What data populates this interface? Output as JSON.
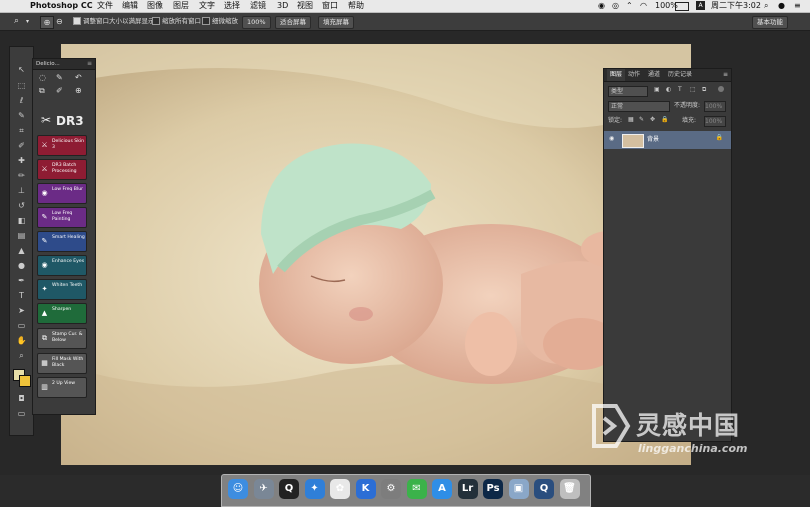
{
  "menubar": {
    "app_name": "Photoshop CC",
    "items": [
      "文件",
      "编辑",
      "图像",
      "图层",
      "文字",
      "选择",
      "滤镜",
      "3D",
      "视图",
      "窗口",
      "帮助"
    ],
    "battery": "100%",
    "clock": "周二下午3:02",
    "input_indicator": "A"
  },
  "options_bar": {
    "resize_windows_label": "调整窗口大小以满屏显示",
    "zoom_all_label": "缩放所有窗口",
    "scrubby_zoom_label": "细微缩放",
    "zoom_percent": "100%",
    "fit_screen_label": "适合屏幕",
    "fill_screen_label": "填充屏幕",
    "workspace_label": "基本功能"
  },
  "delicious_panel": {
    "title": "Delicio...",
    "logo_text": "DR3",
    "buttons": [
      {
        "label": "Delicious Skin 3",
        "color": "#8e1c33"
      },
      {
        "label": "DR3 Batch Processing",
        "color": "#8e1c33"
      },
      {
        "label": "Low Freq Blur",
        "color": "#6b2b86"
      },
      {
        "label": "Low Freq Painting",
        "color": "#6b2b86"
      },
      {
        "label": "Smart Healing",
        "color": "#2e4b8a"
      },
      {
        "label": "Enhance Eyes",
        "color": "#1f5866"
      },
      {
        "label": "Whiten Teeth",
        "color": "#1f5866"
      },
      {
        "label": "Sharpen",
        "color": "#1f6b3a"
      },
      {
        "label": "Stamp Cur. & Below",
        "color": "#555555"
      },
      {
        "label": "Fill Mask With Black",
        "color": "#555555"
      },
      {
        "label": "2 Up View",
        "color": "#555555"
      }
    ]
  },
  "layers_panel": {
    "tabs": [
      "图层",
      "动作",
      "通道",
      "历史记录"
    ],
    "filter_kind": "类型",
    "blend_mode": "正常",
    "opacity_label": "不透明度:",
    "opacity_value": "100%",
    "lock_label": "锁定:",
    "fill_label": "填充:",
    "fill_value": "100%",
    "layers": [
      {
        "name": "背景"
      }
    ]
  },
  "watermark": {
    "name": "灵感中国",
    "url": "lingganchina.com"
  },
  "dock": {
    "apps": [
      {
        "icon": "finder-icon",
        "color": "#3d8de0",
        "glyph": "☺"
      },
      {
        "icon": "launchpad-icon",
        "color": "#7a8796",
        "glyph": "✈"
      },
      {
        "icon": "qq-icon",
        "color": "#222222",
        "glyph": "Q"
      },
      {
        "icon": "safari-icon",
        "color": "#2f7fd8",
        "glyph": "✦"
      },
      {
        "icon": "photos-icon",
        "color": "#e8e8e8",
        "glyph": "✿"
      },
      {
        "icon": "kugou-icon",
        "color": "#2c6ed5",
        "glyph": "K"
      },
      {
        "icon": "system-preferences-icon",
        "color": "#7d7d7d",
        "glyph": "⚙"
      },
      {
        "icon": "wechat-icon",
        "color": "#3bb24a",
        "glyph": "✉"
      },
      {
        "icon": "app-store-icon",
        "color": "#2f8ee6",
        "glyph": "A"
      },
      {
        "icon": "lightroom-icon",
        "color": "#23303a",
        "glyph": "Lr"
      },
      {
        "icon": "photoshop-icon",
        "color": "#0d2847",
        "glyph": "Ps"
      },
      {
        "icon": "preview-icon",
        "color": "#8aa7c8",
        "glyph": "▣"
      },
      {
        "icon": "quicktime-icon",
        "color": "#2a4e7e",
        "glyph": "Q"
      },
      {
        "icon": "trash-icon",
        "color": "#bfbfbf",
        "glyph": "🗑"
      }
    ]
  }
}
